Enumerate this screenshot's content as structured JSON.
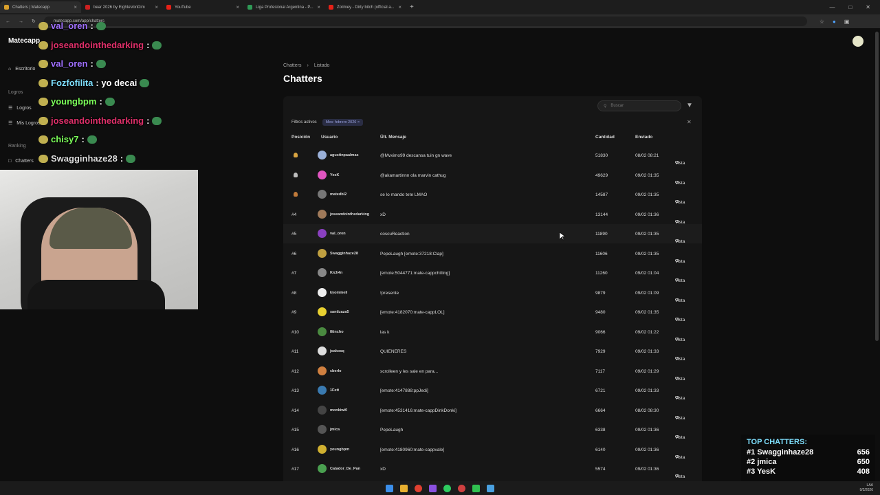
{
  "browser": {
    "tabs": [
      {
        "label": "Chatters | Matecapp",
        "fav": "#d9a02b",
        "active": true
      },
      {
        "label": "bear 2026 by EighteVonDim",
        "fav": "#cc2020",
        "active": false
      },
      {
        "label": "YouTube",
        "fav": "#e62117",
        "active": false
      },
      {
        "label": "Liga Profesional Argentina - P...",
        "fav": "#2f9a56",
        "active": false
      },
      {
        "label": "Zolimey - Dirty bitch (official a...",
        "fav": "#e62117",
        "active": false
      }
    ],
    "url": "matecapp.com/app/chatters"
  },
  "sidebar": {
    "brand": "Matecapp",
    "escritorio": "Escritorio",
    "logros_section": "Logros",
    "logros": "Logros",
    "mis_logros": "Mis Logros",
    "ranking_section": "Ranking",
    "chatters": "Chatters"
  },
  "stream_chat": [
    {
      "user": "val_oren",
      "text": ":",
      "color": "#a070ff"
    },
    {
      "user": "joseandointhedarking",
      "text": ":",
      "color": "#e0306a"
    },
    {
      "user": "val_oren",
      "text": ":",
      "color": "#a070ff"
    },
    {
      "user": "Fozfofilita",
      "text": ": yo decai",
      "color": "#7fe0ff"
    },
    {
      "user": "youngbpm",
      "text": ":",
      "color": "#7cff5a"
    },
    {
      "user": "joseandointhedarking",
      "text": ":",
      "color": "#e0306a"
    },
    {
      "user": "chisy7",
      "text": ":",
      "color": "#7cff5a"
    },
    {
      "user": "Swagginhaze28",
      "text": ":",
      "color": "#dddddd"
    }
  ],
  "breadcrumb": {
    "first": "Chatters",
    "second": "Listado"
  },
  "page_title": "Chatters",
  "search": {
    "placeholder": "Buscar"
  },
  "filters": {
    "label": "Filtros activos",
    "chip": "Mes: febrero 2026"
  },
  "columns": {
    "pos": "Posición",
    "user": "Usuario",
    "msg": "Últ. Mensaje",
    "cnt": "Cantidad",
    "date": "Enviado"
  },
  "rows": [
    {
      "pos": "",
      "user": "agustinpaalmas",
      "msg": "@Mvximo99 descansa tuin gn wave",
      "cnt": "51830",
      "date": "08/02 08:21",
      "vista": "Vista",
      "medal": "#d9a441",
      "avatar": "#9ab0d8"
    },
    {
      "pos": "",
      "user": "YesK",
      "msg": "@akamartinnn ola marvin cathug",
      "cnt": "49629",
      "date": "09/02 01:35",
      "vista": "Vista",
      "medal": "#bdbdbd",
      "avatar": "#e055c0"
    },
    {
      "pos": "",
      "user": "matedbl2",
      "msg": "se lo mando tete LMAO",
      "cnt": "14587",
      "date": "09/02 01:35",
      "vista": "Vista",
      "medal": "#c07a3a",
      "avatar": "#777777"
    },
    {
      "pos": "#4",
      "user": "joseandointhedarking",
      "msg": "xD",
      "cnt": "13144",
      "date": "09/02 01:36",
      "vista": "Vista",
      "avatar": "#a07a5a"
    },
    {
      "pos": "#5",
      "user": "val_oren",
      "msg": "coscuReaction",
      "cnt": "11890",
      "date": "09/02 01:35",
      "vista": "Vista",
      "avatar": "#8a40c0"
    },
    {
      "pos": "#6",
      "user": "Swagginhaze28",
      "msg": "PepeLaugh [emote:37218:Clap]",
      "cnt": "11606",
      "date": "09/02 01:35",
      "vista": "Vista",
      "avatar": "#c0a040"
    },
    {
      "pos": "#7",
      "user": "Kich4n",
      "msg": "[emote:5044771:mate-cappchilling]",
      "cnt": "11260",
      "date": "09/02 01:04",
      "vista": "Vista",
      "avatar": "#888888"
    },
    {
      "pos": "#8",
      "user": "kyommeil",
      "msg": "!presente",
      "cnt": "9879",
      "date": "09/02 01:09",
      "vista": "Vista",
      "avatar": "#eeeeee"
    },
    {
      "pos": "#9",
      "user": "santizaza5",
      "msg": "[emote:4182070:mate-cappLOL]",
      "cnt": "9480",
      "date": "09/02 01:35",
      "vista": "Vista",
      "avatar": "#e8d030"
    },
    {
      "pos": "#10",
      "user": "8tincho",
      "msg": "las k",
      "cnt": "9066",
      "date": "09/02 01:22",
      "vista": "Vista",
      "avatar": "#4a8a40"
    },
    {
      "pos": "#11",
      "user": "joakosq",
      "msg": "QUIENERES",
      "cnt": "7929",
      "date": "09/02 01:33",
      "vista": "Vista",
      "avatar": "#dddddd"
    },
    {
      "pos": "#12",
      "user": "cberlo",
      "msg": "scrolleen y les sale en para...",
      "cnt": "7117",
      "date": "09/02 01:29",
      "vista": "Vista",
      "avatar": "#d08040"
    },
    {
      "pos": "#13",
      "user": "1Fett",
      "msg": "[emote:4147888:ppJedi]",
      "cnt": "6721",
      "date": "09/02 01:33",
      "vista": "Vista",
      "avatar": "#3a7ab0"
    },
    {
      "pos": "#14",
      "user": "monkiwi0",
      "msg": "[emote:4531416:mate-cappDinkDonki]",
      "cnt": "6664",
      "date": "08/02 08:30",
      "vista": "Vista",
      "avatar": "#444444"
    },
    {
      "pos": "#15",
      "user": "jmica",
      "msg": "PepeLaugh",
      "cnt": "6338",
      "date": "09/02 01:36",
      "vista": "Vista",
      "avatar": "#555555"
    },
    {
      "pos": "#16",
      "user": "youngbpm",
      "msg": "[emote:4180960:mate-cappvale]",
      "cnt": "6140",
      "date": "09/02 01:36",
      "vista": "Vista",
      "avatar": "#d0b030"
    },
    {
      "pos": "#17",
      "user": "Catador_De_Pan",
      "msg": "xD",
      "cnt": "5574",
      "date": "09/02 01:36",
      "vista": "Vista",
      "avatar": "#4aa050"
    }
  ],
  "top_chatters": {
    "title": "TOP CHATTERS:",
    "entries": [
      {
        "rank": "#1",
        "name": "Swagginhaze28",
        "count": "656"
      },
      {
        "rank": "#2",
        "name": "jmica",
        "count": "650"
      },
      {
        "rank": "#3",
        "name": "YesK",
        "count": "408"
      }
    ]
  },
  "tray": {
    "lang": "LAA",
    "time": "",
    "date": "9/2/2026"
  }
}
